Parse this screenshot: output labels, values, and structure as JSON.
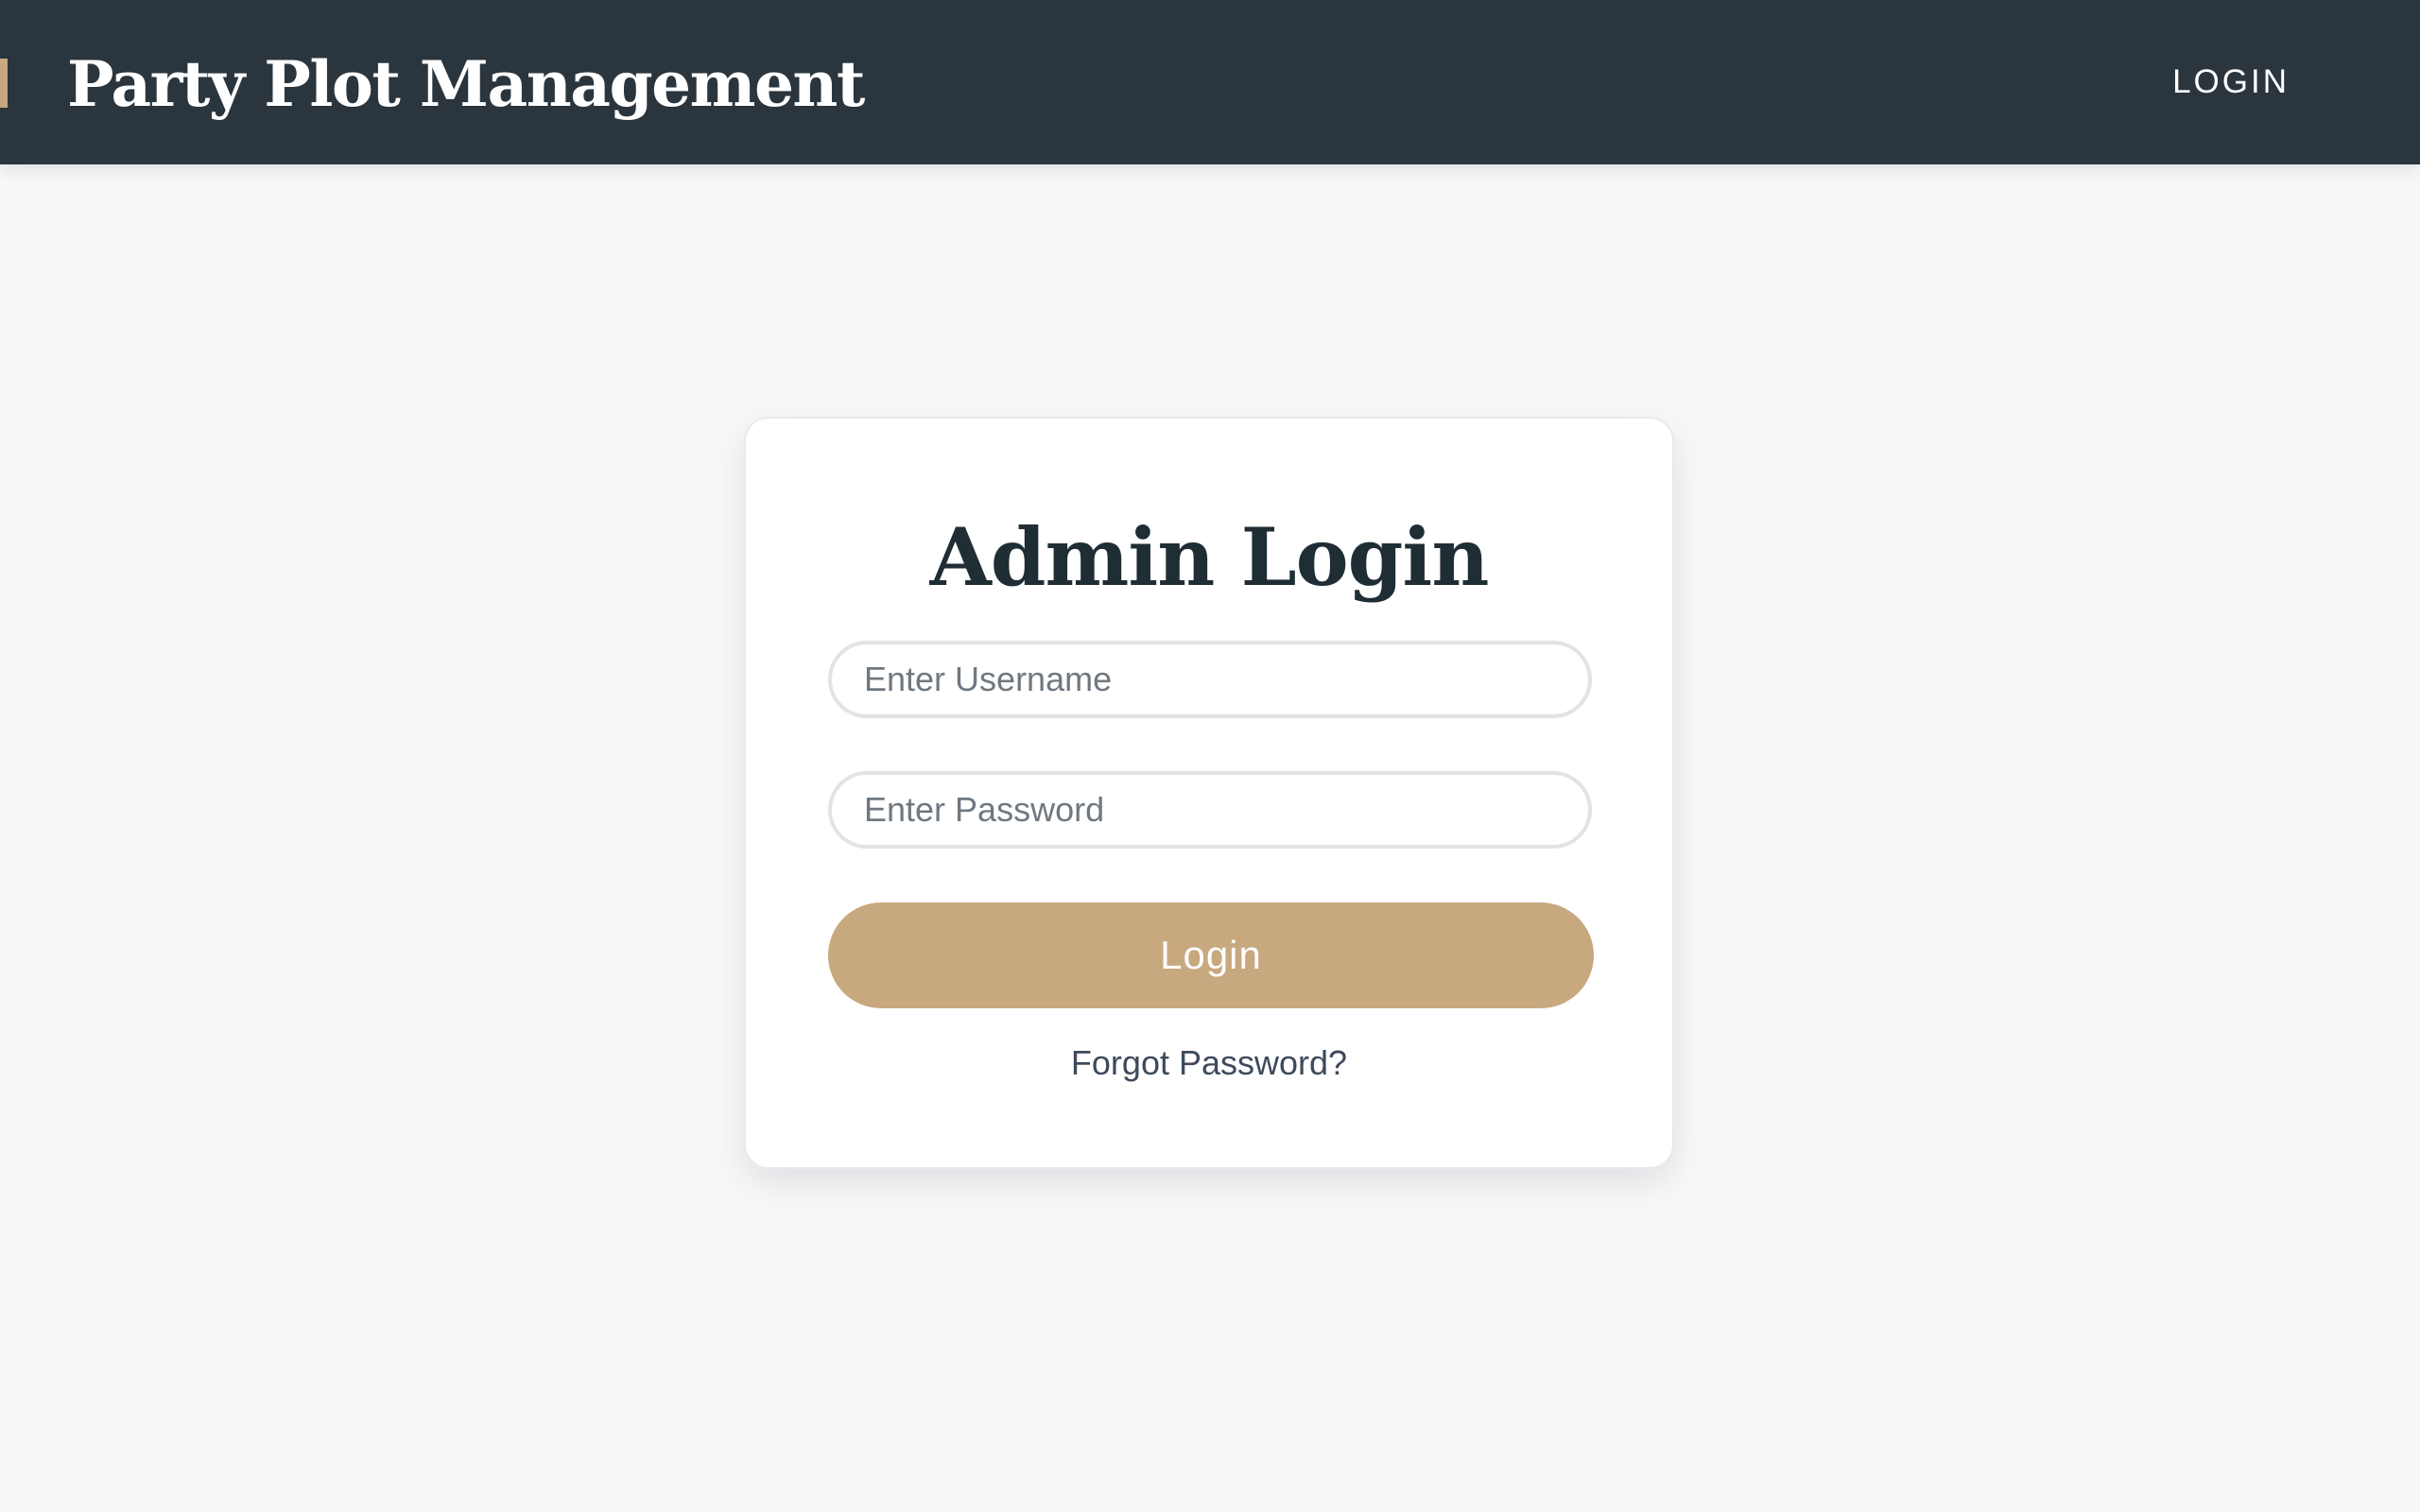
{
  "navbar": {
    "brand_title": "Party Plot Management",
    "login_link": "LOGIN"
  },
  "login_card": {
    "title": "Admin Login",
    "username_placeholder": "Enter Username",
    "password_placeholder": "Enter Password",
    "submit_label": "Login",
    "forgot_password_label": "Forgot Password?"
  },
  "colors": {
    "navbar_bg": "#2b353d",
    "accent": "#c8a87e",
    "page_bg": "#f7f8fa",
    "title_text": "#1f2d35"
  }
}
